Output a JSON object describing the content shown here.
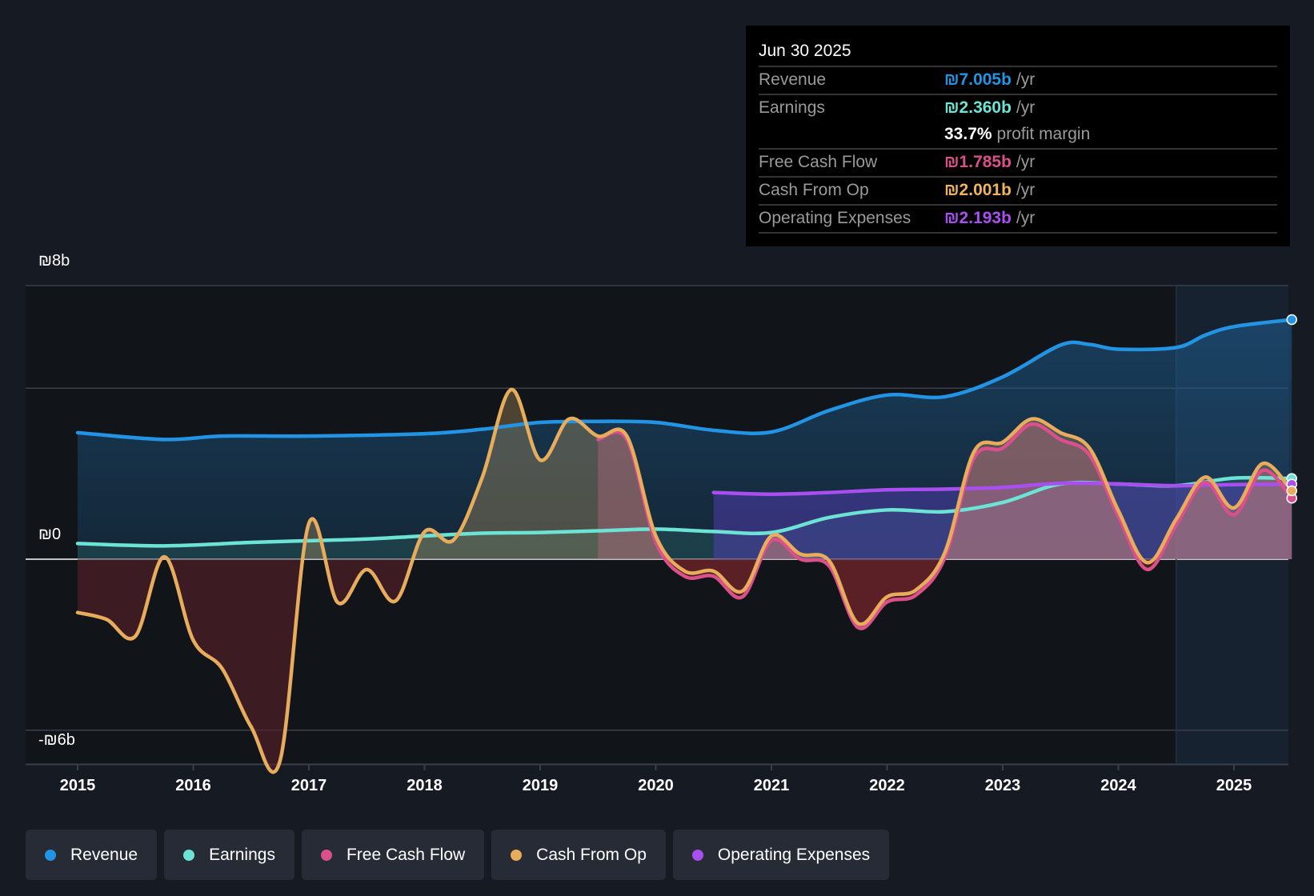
{
  "tooltip": {
    "date": "Jun 30 2025",
    "rows": [
      {
        "label": "Revenue",
        "value": "₪7.005b",
        "unit": "/yr",
        "color": "#2394e4"
      },
      {
        "label": "Earnings",
        "value": "₪2.360b",
        "unit": "/yr",
        "color": "#6ce3d4"
      },
      {
        "label": "",
        "value": "33.7%",
        "unit": "profit margin",
        "color": "#ffffff"
      },
      {
        "label": "Free Cash Flow",
        "value": "₪1.785b",
        "unit": "/yr",
        "color": "#d9508a"
      },
      {
        "label": "Cash From Op",
        "value": "₪2.001b",
        "unit": "/yr",
        "color": "#f0b45c"
      },
      {
        "label": "Operating Expenses",
        "value": "₪2.193b",
        "unit": "/yr",
        "color": "#a94ff0"
      }
    ]
  },
  "legend": [
    {
      "label": "Revenue",
      "color": "#2394e4"
    },
    {
      "label": "Earnings",
      "color": "#6ce3d4"
    },
    {
      "label": "Free Cash Flow",
      "color": "#d9508a"
    },
    {
      "label": "Cash From Op",
      "color": "#e8ad5c"
    },
    {
      "label": "Operating Expenses",
      "color": "#a94ff0"
    }
  ],
  "chart_data": {
    "type": "line",
    "title": "",
    "xlabel": "",
    "ylabel": "",
    "unit": "₪ billions",
    "xlim": [
      2015,
      2025.5
    ],
    "ylim": [
      -6,
      8
    ],
    "y_ticks": [
      {
        "value": 8,
        "label": "₪8b"
      },
      {
        "value": 0,
        "label": "₪0"
      },
      {
        "value": -6,
        "label": "-₪6b"
      }
    ],
    "gridlines": [
      8,
      5,
      0,
      -5
    ],
    "x_ticks": [
      "2015",
      "2016",
      "2017",
      "2018",
      "2019",
      "2020",
      "2021",
      "2022",
      "2023",
      "2024",
      "2025"
    ],
    "forecast_start": 2024.5,
    "series": [
      {
        "name": "Revenue",
        "color": "#2394e4",
        "x": [
          2015,
          2015.75,
          2016.25,
          2017,
          2018,
          2018.5,
          2019,
          2019.5,
          2020,
          2020.5,
          2021,
          2021.5,
          2022,
          2022.5,
          2023,
          2023.5,
          2023.75,
          2024,
          2024.5,
          2024.75,
          2025,
          2025.5
        ],
        "y": [
          3.7,
          3.5,
          3.6,
          3.6,
          3.67,
          3.8,
          4.0,
          4.03,
          4.0,
          3.77,
          3.72,
          4.35,
          4.8,
          4.75,
          5.33,
          6.26,
          6.28,
          6.14,
          6.19,
          6.55,
          6.8,
          7.005
        ]
      },
      {
        "name": "Earnings",
        "color": "#6ce3d4",
        "x": [
          2015,
          2015.75,
          2016.5,
          2017,
          2017.5,
          2018,
          2018.5,
          2019,
          2019.5,
          2020,
          2020.5,
          2021,
          2021.5,
          2022,
          2022.5,
          2023,
          2023.5,
          2024,
          2024.5,
          2025,
          2025.5
        ],
        "y": [
          0.46,
          0.39,
          0.49,
          0.54,
          0.59,
          0.68,
          0.76,
          0.78,
          0.83,
          0.88,
          0.81,
          0.78,
          1.22,
          1.44,
          1.39,
          1.66,
          2.2,
          2.2,
          2.15,
          2.37,
          2.36
        ]
      },
      {
        "name": "Cash From Op",
        "color": "#e8ad5c",
        "x": [
          2015,
          2015.25,
          2015.5,
          2015.75,
          2016,
          2016.25,
          2016.5,
          2016.75,
          2017,
          2017.25,
          2017.5,
          2017.75,
          2018,
          2018.25,
          2018.5,
          2018.75,
          2019,
          2019.25,
          2019.5,
          2019.75,
          2020,
          2020.25,
          2020.5,
          2020.75,
          2021,
          2021.25,
          2021.5,
          2021.75,
          2022,
          2022.25,
          2022.5,
          2022.75,
          2023,
          2023.25,
          2023.5,
          2023.75,
          2024,
          2024.25,
          2024.5,
          2024.75,
          2025,
          2025.25,
          2025.5
        ],
        "y": [
          -1.56,
          -1.76,
          -2.25,
          0.07,
          -2.37,
          -3.2,
          -4.9,
          -5.9,
          1.05,
          -1.27,
          -0.3,
          -1.22,
          0.8,
          0.56,
          2.4,
          4.96,
          2.9,
          4.1,
          3.6,
          3.6,
          0.68,
          -0.35,
          -0.35,
          -0.93,
          0.68,
          0.15,
          -0.05,
          -1.88,
          -1.1,
          -0.9,
          0.2,
          3.13,
          3.42,
          4.1,
          3.7,
          3.25,
          1.42,
          -0.1,
          1.17,
          2.4,
          1.5,
          2.8,
          2.001
        ]
      },
      {
        "name": "Free Cash Flow",
        "color": "#d9508a",
        "x": [
          2019.5,
          2019.75,
          2020,
          2020.25,
          2020.5,
          2020.75,
          2021,
          2021.25,
          2021.5,
          2021.75,
          2022,
          2022.25,
          2022.5,
          2022.75,
          2023,
          2023.25,
          2023.5,
          2023.75,
          2024,
          2024.25,
          2024.5,
          2024.75,
          2025,
          2025.25,
          2025.5
        ],
        "y": [
          3.5,
          3.5,
          0.5,
          -0.5,
          -0.5,
          -1.1,
          0.55,
          0.0,
          -0.2,
          -2.0,
          -1.25,
          -1.05,
          0.05,
          2.95,
          3.25,
          3.95,
          3.5,
          3.05,
          1.25,
          -0.3,
          1.0,
          2.25,
          1.3,
          2.6,
          1.785
        ]
      },
      {
        "name": "Operating Expenses",
        "color": "#a94ff0",
        "x": [
          2020.5,
          2021,
          2021.5,
          2022,
          2022.5,
          2023,
          2023.5,
          2024,
          2024.5,
          2025,
          2025.5
        ],
        "y": [
          1.95,
          1.9,
          1.95,
          2.03,
          2.05,
          2.1,
          2.22,
          2.2,
          2.15,
          2.18,
          2.193
        ]
      }
    ]
  }
}
